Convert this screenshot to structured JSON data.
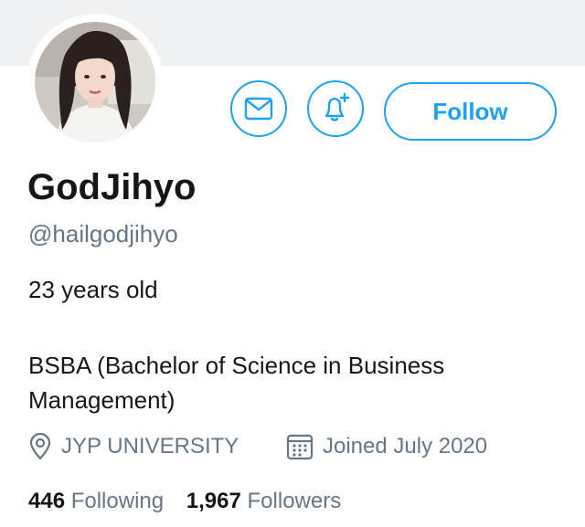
{
  "profile": {
    "display_name": "GodJihyo",
    "handle": "@hailgodjihyo",
    "bio_line1": "23 years old",
    "bio_line2": "BSBA (Bachelor of Science in Business Management)",
    "location": "JYP UNIVERSITY",
    "joined": "Joined July 2020"
  },
  "actions": {
    "message_icon": "envelope-icon",
    "notify_icon": "bell-plus-icon",
    "follow_label": "Follow"
  },
  "stats": {
    "following_count": "446",
    "following_label": "Following",
    "followers_count": "1,967",
    "followers_label": "Followers"
  },
  "colors": {
    "accent": "#1da1f2",
    "secondary_text": "#657786",
    "primary_text": "#14171a",
    "banner": "#eff1f3"
  }
}
